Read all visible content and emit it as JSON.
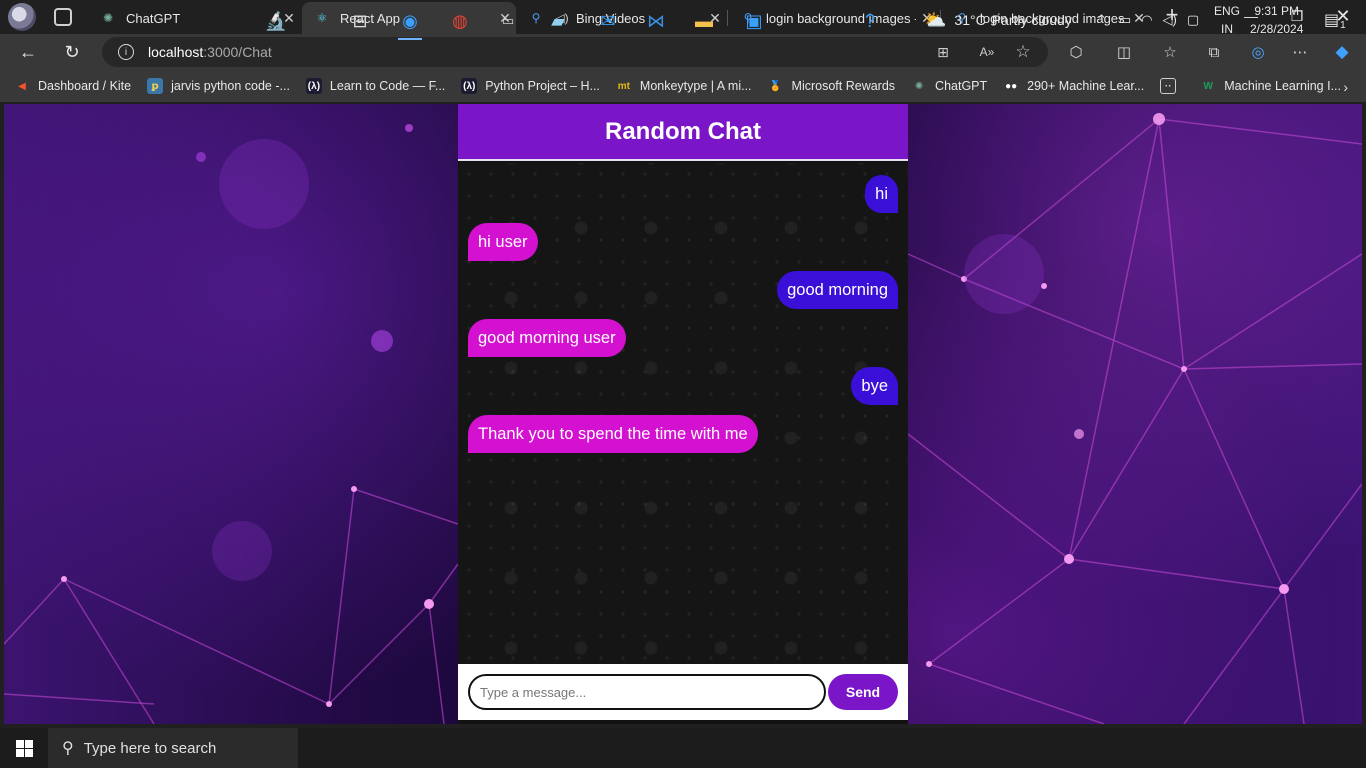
{
  "browser": {
    "tabs": [
      {
        "label": "ChatGPT",
        "icon": "chatgpt-icon",
        "active": false
      },
      {
        "label": "React App",
        "icon": "react-icon",
        "active": true
      },
      {
        "label": "Bing Videos",
        "icon": "search-icon",
        "active": false
      },
      {
        "label": "login background images -",
        "icon": "search-icon",
        "active": false
      },
      {
        "label": "login background images -",
        "icon": "search-icon",
        "active": false
      }
    ],
    "url_host": "localhost",
    "url_path": ":3000/Chat",
    "bookmarks": [
      {
        "label": "Dashboard / Kite",
        "icon": "kite-icon",
        "color": "#f5512f"
      },
      {
        "label": "jarvis python code -...",
        "icon": "python-icon",
        "color": "#3b77a8"
      },
      {
        "label": "Learn to Code — F...",
        "icon": "freecodecamp-icon",
        "color": "#1b1b32"
      },
      {
        "label": "Python Project – H...",
        "icon": "freecodecamp-icon",
        "color": "#1b1b32"
      },
      {
        "label": "Monkeytype | A mi...",
        "icon": "monkeytype-icon",
        "color": "#e2b714"
      },
      {
        "label": "Microsoft Rewards",
        "icon": "rewards-icon",
        "color": "#f0a030"
      },
      {
        "label": "ChatGPT",
        "icon": "chatgpt-icon",
        "color": "#74aa9c"
      },
      {
        "label": "290+ Machine Lear...",
        "icon": "medium-icon",
        "color": "#ffffff"
      },
      {
        "label": "",
        "icon": "calendar-icon",
        "color": "#d0d0d0"
      },
      {
        "label": "Machine Learning I...",
        "icon": "w-logo-icon",
        "color": "#1f9e5a"
      }
    ]
  },
  "chat": {
    "title": "Random Chat",
    "messages": [
      {
        "text": "hi",
        "side": "sent"
      },
      {
        "text": "hi user",
        "side": "recv"
      },
      {
        "text": "good morning",
        "side": "sent"
      },
      {
        "text": "good morning user",
        "side": "recv"
      },
      {
        "text": "bye",
        "side": "sent"
      },
      {
        "text": "Thank you to spend the time with me",
        "side": "recv"
      }
    ],
    "input_placeholder": "Type a message...",
    "send_label": "Send",
    "colors": {
      "header": "#7b16c8",
      "sent": "#3a10d8",
      "received": "#d411d0"
    }
  },
  "taskbar": {
    "search_placeholder": "Type here to search",
    "weather_temp": "31°C",
    "weather_text": "Partly cloudy",
    "lang_line1": "ENG",
    "lang_line2": "IN",
    "time": "9:31 PM",
    "date": "2/28/2024",
    "notification_count": "1"
  }
}
